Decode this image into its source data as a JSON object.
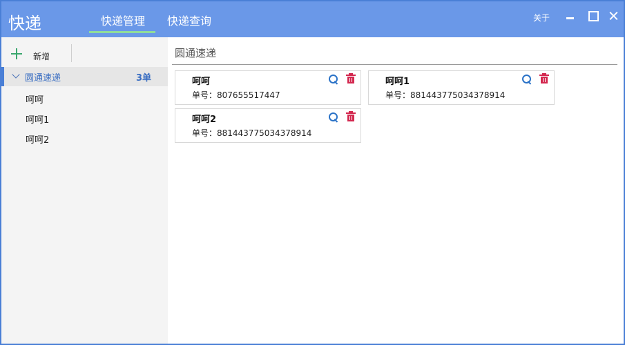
{
  "app": {
    "title": "快递"
  },
  "tabs": [
    {
      "label": "快递管理",
      "active": true
    },
    {
      "label": "快递查询",
      "active": false
    }
  ],
  "titlebar": {
    "about": "关于"
  },
  "toolbar": {
    "add_label": "新增"
  },
  "sidebar": {
    "group": {
      "name": "圆通速递",
      "count": "3单"
    },
    "items": [
      {
        "label": "呵呵"
      },
      {
        "label": "呵呵1"
      },
      {
        "label": "呵呵2"
      }
    ]
  },
  "main": {
    "section_title": "圆通速递",
    "cards": [
      {
        "name": "呵呵",
        "number": "单号：807655517447"
      },
      {
        "name": "呵呵1",
        "number": "单号：881443775034378914"
      },
      {
        "name": "呵呵2",
        "number": "单号：881443775034378914"
      }
    ]
  },
  "colors": {
    "titlebar": "#6a98e8",
    "tab_underline": "#8fdc9b",
    "accent": "#3a6ec2",
    "search": "#2a72c7",
    "delete": "#d3284f",
    "add": "#3aa76d"
  }
}
